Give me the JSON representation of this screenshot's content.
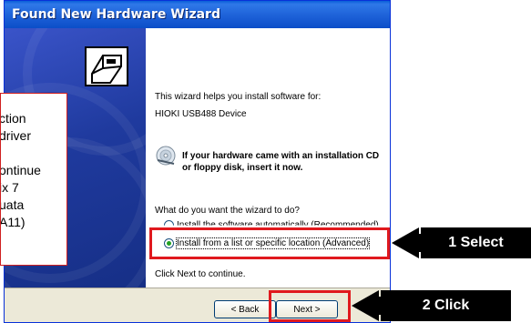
{
  "window": {
    "title": "Found New Hardware Wizard"
  },
  "intro": {
    "line": "This wizard helps you install software for:",
    "device": "HIOKI USB488 Device"
  },
  "cd_hint": {
    "line1": "If your hardware came with an installation CD",
    "line2": "or floppy disk, insert it now."
  },
  "question": "What do you want the wizard to do?",
  "options": [
    {
      "label": "Install the software automatically (Recommended)",
      "selected": false
    },
    {
      "label": "Install from a list or specific location (Advanced)",
      "selected": true
    }
  ],
  "footer_hint": "Click Next to continue.",
  "buttons": {
    "back": "< Back",
    "next": "Next >"
  },
  "note_lines": [
    "ction",
    "driver",
    "",
    "ontinue",
    "ix 7",
    "uata",
    "A11)"
  ],
  "callouts": {
    "select": "1  Select",
    "click": "2  Click"
  },
  "colors": {
    "title_bar": "#2f78e8",
    "highlight": "#e0191e",
    "callout": "#000000"
  },
  "icons": [
    "wizard-hardware-icon",
    "cd-icon"
  ]
}
